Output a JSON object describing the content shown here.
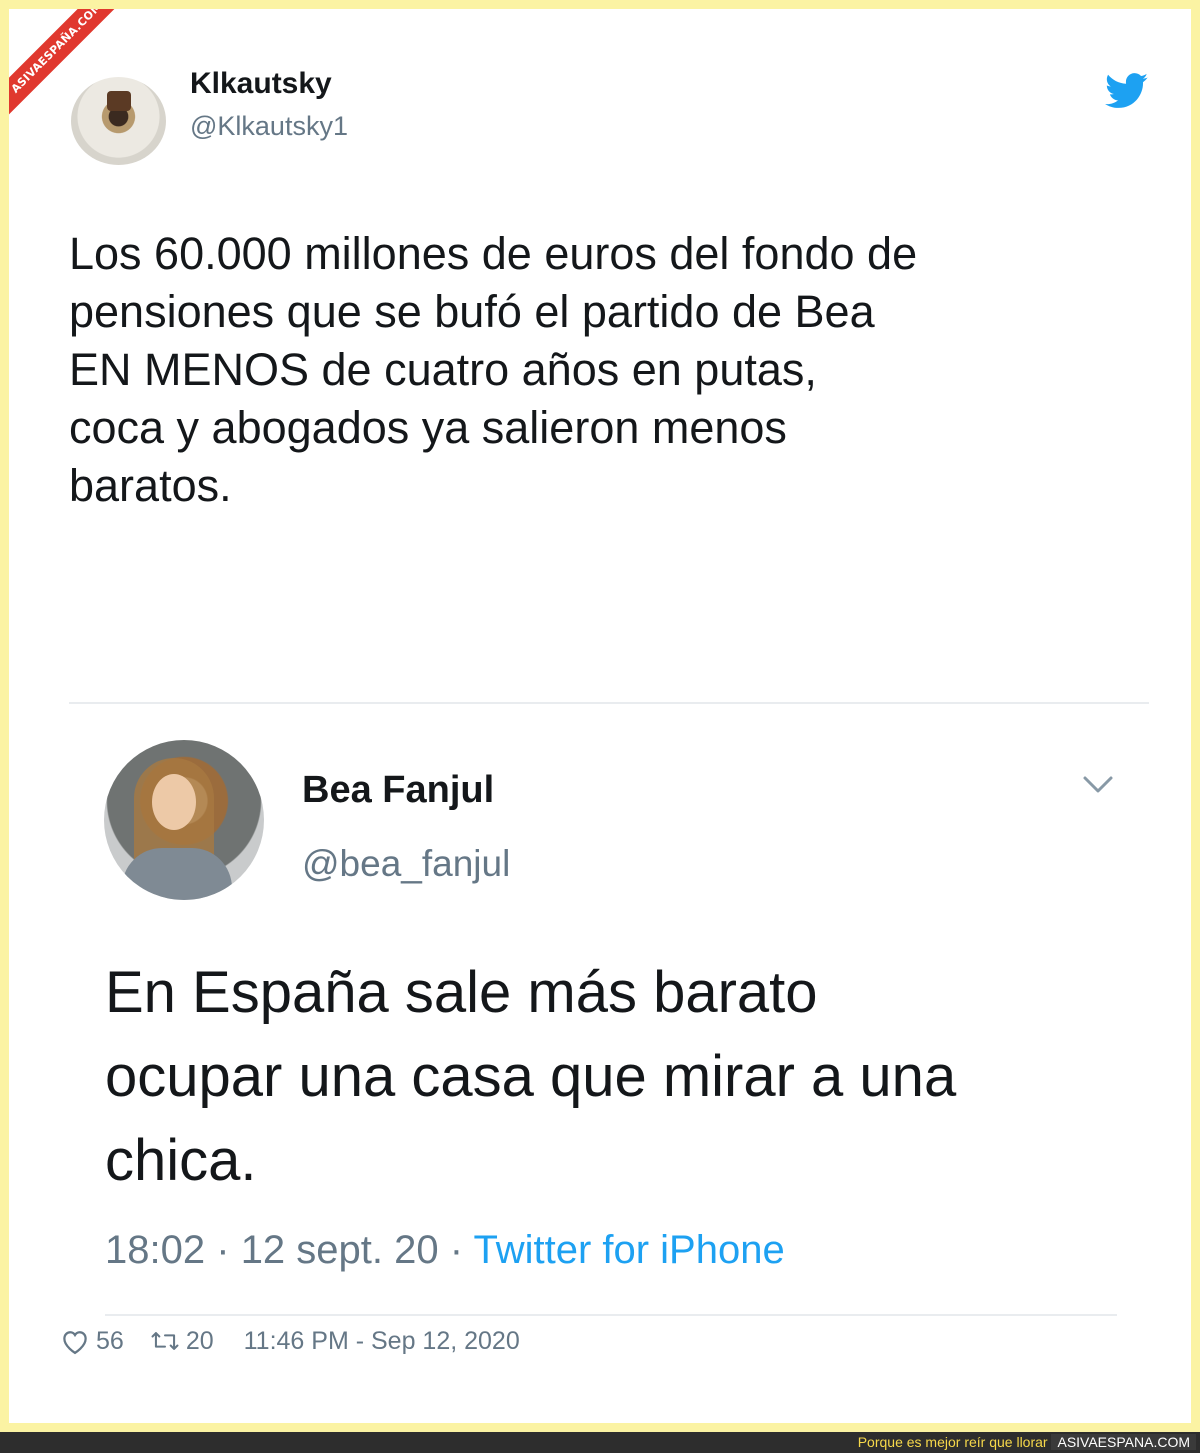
{
  "watermark": {
    "corner_text": "ASIVAESPAÑA.COM"
  },
  "main_tweet": {
    "display_name": "Klkautsky",
    "handle": "@Klkautsky1",
    "text": "Los 60.000 millones de euros del fondo de\npensiones que se bufó el partido de Bea\nEN MENOS de cuatro años en putas,\ncoca y abogados ya salieron menos\nbaratos.",
    "likes": "56",
    "retweets": "20",
    "timestamp": "11:46 PM - Sep 12, 2020"
  },
  "quoted_tweet": {
    "display_name": "Bea Fanjul",
    "handle": "@bea_fanjul",
    "text": "En España sale más barato\nocupar una casa que mirar a una\nchica.",
    "time": "18:02",
    "date": "12 sept. 20",
    "separator": "·",
    "source": "Twitter for iPhone"
  },
  "footer_bar": {
    "slogan": "Porque es mejor reír que llorar",
    "site": "ASIVAESPANA.COM"
  },
  "colors": {
    "frame": "#fbf3a3",
    "twitter_blue": "#1da1f2",
    "ribbon": "#e0382e",
    "muted_text": "#657786"
  },
  "icons": [
    "twitter-bird-icon",
    "chevron-down-icon",
    "heart-icon",
    "retweet-icon"
  ]
}
